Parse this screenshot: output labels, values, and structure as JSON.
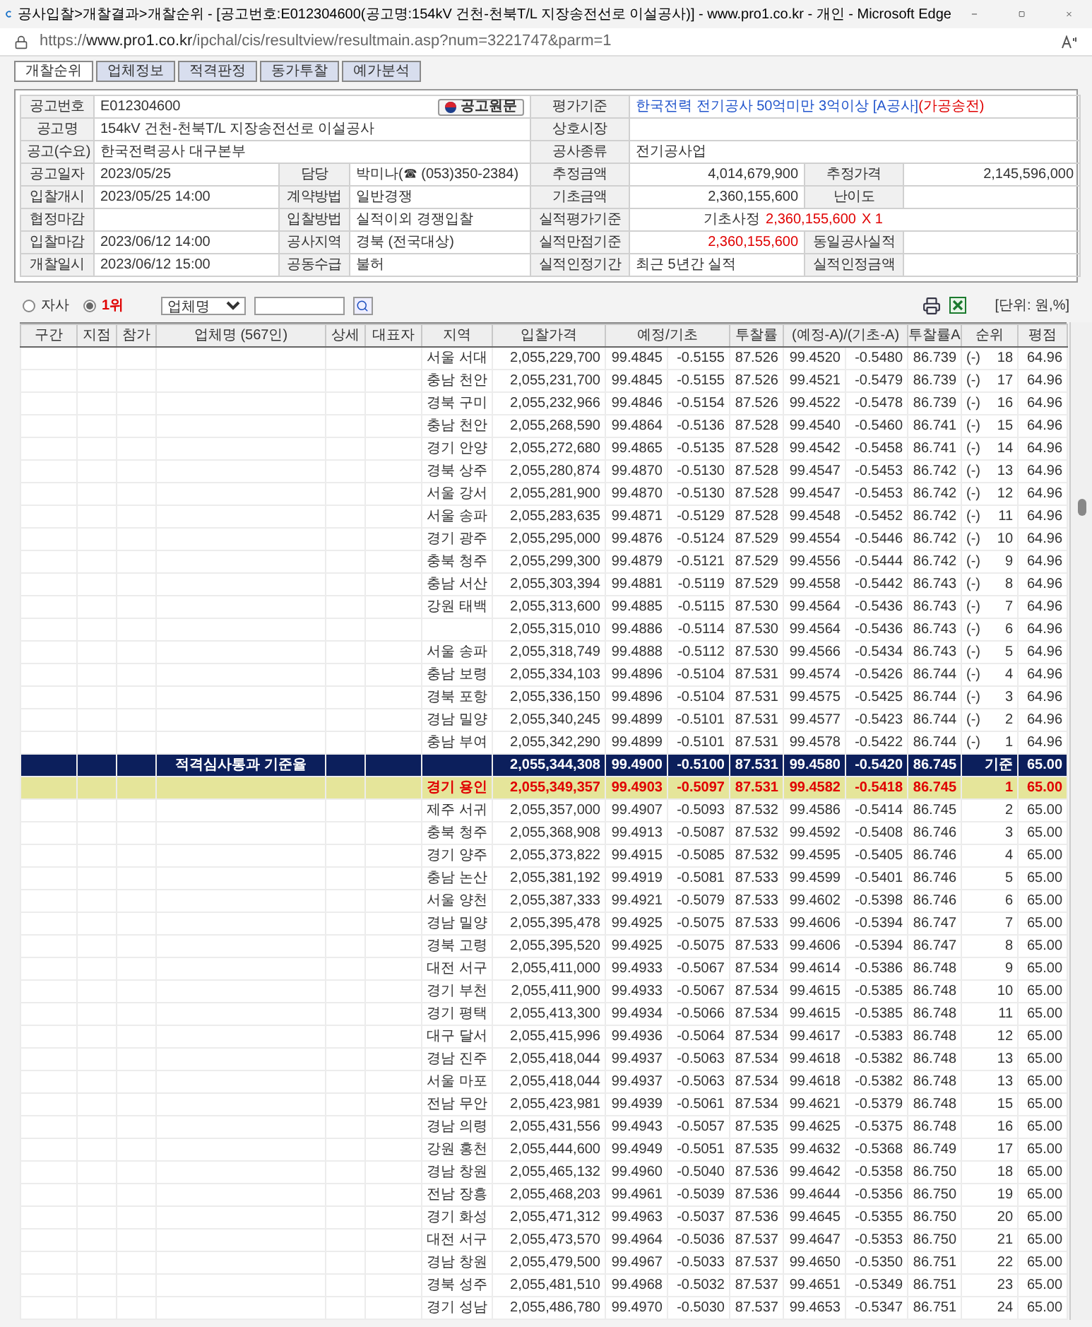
{
  "window": {
    "title": "공사입찰>개찰결과>개찰순위 - [공고번호:E012304600(공고명:154kV 건천-천북T/L 지장송전선로 이설공사)] - www.pro1.co.kr - 개인 - Microsoft Edge",
    "url_prefix": "https://",
    "url_domain": "www.pro1.co.kr",
    "url_path": "/ipchal/cis/resultview/resultmain.asp?num=3221747&parm=1"
  },
  "tabs": [
    {
      "label": "개찰순위",
      "selected": true
    },
    {
      "label": "업체정보",
      "selected": false
    },
    {
      "label": "적격판정",
      "selected": false
    },
    {
      "label": "동가투찰",
      "selected": false
    },
    {
      "label": "예가분석",
      "selected": false
    }
  ],
  "info_rows": [
    [
      {
        "kind": "label",
        "text": "공고번호"
      },
      {
        "kind": "notice",
        "text": "E012304600",
        "button": "공고원문"
      },
      {
        "kind": "label",
        "text": "평가기준"
      },
      {
        "kind": "text",
        "parts": [
          {
            "text": "한국전력 전기공사  50억미만 3억이상 [A공사]",
            "color": "#2255cc"
          },
          {
            "text": "(가공송전)",
            "color": "#e00000"
          }
        ]
      }
    ],
    [
      {
        "kind": "label",
        "text": "공고명"
      },
      {
        "kind": "text",
        "text": "154kV 건천-천북T/L 지장송전선로 이설공사"
      },
      {
        "kind": "label",
        "text": "상호시장"
      },
      {
        "kind": "empty"
      }
    ],
    [
      {
        "kind": "label",
        "text": "공고(수요)"
      },
      {
        "kind": "text",
        "text": "한국전력공사 대구본부"
      },
      {
        "kind": "label",
        "text": "공사종류"
      },
      {
        "kind": "text",
        "text": "전기공사업"
      }
    ],
    [
      {
        "kind": "label",
        "text": "공고일자"
      },
      {
        "kind": "text",
        "text": "2023/05/25"
      },
      {
        "kind": "label",
        "text": "담당"
      },
      {
        "kind": "text",
        "text": "박미나(☎ (053)350-2384)"
      },
      {
        "kind": "label",
        "text": "추정금액"
      },
      {
        "kind": "amount",
        "text": "4,014,679,900"
      },
      {
        "kind": "label",
        "text": "추정가격"
      },
      {
        "kind": "amount",
        "text": "2,145,596,000"
      }
    ],
    [
      {
        "kind": "label",
        "text": "입찰개시"
      },
      {
        "kind": "text",
        "text": "2023/05/25 14:00"
      },
      {
        "kind": "label",
        "text": "계약방법"
      },
      {
        "kind": "text",
        "text": "일반경쟁"
      },
      {
        "kind": "label",
        "text": "기초금액"
      },
      {
        "kind": "amount",
        "text": "2,360,155,600"
      },
      {
        "kind": "label",
        "text": "난이도"
      },
      {
        "kind": "empty"
      }
    ],
    [
      {
        "kind": "label",
        "text": "협정마감"
      },
      {
        "kind": "empty"
      },
      {
        "kind": "label",
        "text": "입찰방법"
      },
      {
        "kind": "text",
        "text": "실적이외 경쟁입찰"
      },
      {
        "kind": "label",
        "text": "실적평가기준"
      },
      {
        "kind": "formula",
        "parts": [
          {
            "text": "기초사정",
            "color": "#333333"
          },
          {
            "text": "2,360,155,600",
            "color": "#e00000"
          },
          {
            "text": "X 1",
            "color": "#e00000"
          }
        ]
      }
    ],
    [
      {
        "kind": "label",
        "text": "입찰마감"
      },
      {
        "kind": "text",
        "text": "2023/06/12 14:00"
      },
      {
        "kind": "label",
        "text": "공사지역"
      },
      {
        "kind": "text",
        "text": "경북 (전국대상)"
      },
      {
        "kind": "label",
        "text": "실적만점기준"
      },
      {
        "kind": "amount",
        "text": "2,360,155,600",
        "color": "#e00000"
      },
      {
        "kind": "label",
        "text": "동일공사실적"
      },
      {
        "kind": "empty"
      }
    ],
    [
      {
        "kind": "label",
        "text": "개찰일시"
      },
      {
        "kind": "text",
        "text": "2023/06/12 15:00"
      },
      {
        "kind": "label",
        "text": "공동수급"
      },
      {
        "kind": "text",
        "text": "불허"
      },
      {
        "kind": "label",
        "text": "실적인정기간"
      },
      {
        "kind": "text",
        "text": "최근 5년간 실적"
      },
      {
        "kind": "label",
        "text": "실적인정금액"
      },
      {
        "kind": "empty"
      }
    ]
  ],
  "filter": {
    "radios": [
      {
        "label": "자사",
        "selected": false
      },
      {
        "label": "1위",
        "selected": true
      }
    ],
    "select": "업체명",
    "unit": "[단위: 원,%]"
  },
  "columns": [
    {
      "label": "구간"
    },
    {
      "label": "지점"
    },
    {
      "label": "참가"
    },
    {
      "label": "업체명 (567인)"
    },
    {
      "label": "상세"
    },
    {
      "label": "대표자"
    },
    {
      "label": "지역"
    },
    {
      "label": "입찰가격"
    },
    {
      "label": "예정/기초",
      "kind": "pair"
    },
    {
      "label": "투찰률"
    },
    {
      "label": "(예정-A)/(기초-A)",
      "kind": "pair"
    },
    {
      "label": "투찰률A"
    },
    {
      "label": "순위"
    },
    {
      "label": "평점"
    }
  ],
  "rows": [
    {
      "kind": "normal",
      "region": "서울 서대",
      "values": [
        "2,055,229,700",
        "99.4845",
        "-0.5155",
        "87.526",
        "99.4520",
        "-0.5480",
        "86.739"
      ],
      "rank_mark": "(-)",
      "rank": "18",
      "score": "64.96"
    },
    {
      "kind": "normal",
      "region": "충남 천안",
      "values": [
        "2,055,231,700",
        "99.4845",
        "-0.5155",
        "87.526",
        "99.4521",
        "-0.5479",
        "86.739"
      ],
      "rank_mark": "(-)",
      "rank": "17",
      "score": "64.96"
    },
    {
      "kind": "normal",
      "region": "경북 구미",
      "values": [
        "2,055,232,966",
        "99.4846",
        "-0.5154",
        "87.526",
        "99.4522",
        "-0.5478",
        "86.739"
      ],
      "rank_mark": "(-)",
      "rank": "16",
      "score": "64.96"
    },
    {
      "kind": "normal",
      "region": "충남 천안",
      "values": [
        "2,055,268,590",
        "99.4864",
        "-0.5136",
        "87.528",
        "99.4540",
        "-0.5460",
        "86.741"
      ],
      "rank_mark": "(-)",
      "rank": "15",
      "score": "64.96"
    },
    {
      "kind": "normal",
      "region": "경기 안양",
      "values": [
        "2,055,272,680",
        "99.4865",
        "-0.5135",
        "87.528",
        "99.4542",
        "-0.5458",
        "86.741"
      ],
      "rank_mark": "(-)",
      "rank": "14",
      "score": "64.96"
    },
    {
      "kind": "normal",
      "region": "경북 상주",
      "values": [
        "2,055,280,874",
        "99.4870",
        "-0.5130",
        "87.528",
        "99.4547",
        "-0.5453",
        "86.742"
      ],
      "rank_mark": "(-)",
      "rank": "13",
      "score": "64.96"
    },
    {
      "kind": "normal",
      "region": "서울 강서",
      "values": [
        "2,055,281,900",
        "99.4870",
        "-0.5130",
        "87.528",
        "99.4547",
        "-0.5453",
        "86.742"
      ],
      "rank_mark": "(-)",
      "rank": "12",
      "score": "64.96"
    },
    {
      "kind": "normal",
      "region": "서울 송파",
      "values": [
        "2,055,283,635",
        "99.4871",
        "-0.5129",
        "87.528",
        "99.4548",
        "-0.5452",
        "86.742"
      ],
      "rank_mark": "(-)",
      "rank": "11",
      "score": "64.96"
    },
    {
      "kind": "normal",
      "region": "경기 광주",
      "values": [
        "2,055,295,000",
        "99.4876",
        "-0.5124",
        "87.529",
        "99.4554",
        "-0.5446",
        "86.742"
      ],
      "rank_mark": "(-)",
      "rank": "10",
      "score": "64.96"
    },
    {
      "kind": "normal",
      "region": "충북 청주",
      "values": [
        "2,055,299,300",
        "99.4879",
        "-0.5121",
        "87.529",
        "99.4556",
        "-0.5444",
        "86.742"
      ],
      "rank_mark": "(-)",
      "rank": "9",
      "score": "64.96"
    },
    {
      "kind": "normal",
      "region": "충남 서산",
      "values": [
        "2,055,303,394",
        "99.4881",
        "-0.5119",
        "87.529",
        "99.4558",
        "-0.5442",
        "86.743"
      ],
      "rank_mark": "(-)",
      "rank": "8",
      "score": "64.96"
    },
    {
      "kind": "normal",
      "region": "강원 태백",
      "values": [
        "2,055,313,600",
        "99.4885",
        "-0.5115",
        "87.530",
        "99.4564",
        "-0.5436",
        "86.743"
      ],
      "rank_mark": "(-)",
      "rank": "7",
      "score": "64.96"
    },
    {
      "kind": "normal",
      "values": [
        "2,055,315,010",
        "99.4886",
        "-0.5114",
        "87.530",
        "99.4564",
        "-0.5436",
        "86.743"
      ],
      "rank_mark": "(-)",
      "rank": "6",
      "score": "64.96"
    },
    {
      "kind": "normal",
      "region": "서울 송파",
      "values": [
        "2,055,318,749",
        "99.4888",
        "-0.5112",
        "87.530",
        "99.4566",
        "-0.5434",
        "86.743"
      ],
      "rank_mark": "(-)",
      "rank": "5",
      "score": "64.96"
    },
    {
      "kind": "normal",
      "region": "충남 보령",
      "values": [
        "2,055,334,103",
        "99.4896",
        "-0.5104",
        "87.531",
        "99.4574",
        "-0.5426",
        "86.744"
      ],
      "rank_mark": "(-)",
      "rank": "4",
      "score": "64.96"
    },
    {
      "kind": "normal",
      "region": "경북 포항",
      "values": [
        "2,055,336,150",
        "99.4896",
        "-0.5104",
        "87.531",
        "99.4575",
        "-0.5425",
        "86.744"
      ],
      "rank_mark": "(-)",
      "rank": "3",
      "score": "64.96"
    },
    {
      "kind": "normal",
      "region": "경남 밀양",
      "values": [
        "2,055,340,245",
        "99.4899",
        "-0.5101",
        "87.531",
        "99.4577",
        "-0.5423",
        "86.744"
      ],
      "rank_mark": "(-)",
      "rank": "2",
      "score": "64.96"
    },
    {
      "kind": "normal",
      "region": "충남 부여",
      "values": [
        "2,055,342,290",
        "99.4899",
        "-0.5101",
        "87.531",
        "99.4578",
        "-0.5422",
        "86.744"
      ],
      "rank_mark": "(-)",
      "rank": "1",
      "score": "64.96"
    },
    {
      "kind": "summary",
      "label": "적격심사통과 기준율",
      "values": [
        "2,055,344,308",
        "99.4900",
        "-0.5100",
        "87.531",
        "99.4580",
        "-0.5420",
        "86.745"
      ],
      "rank": "기준",
      "score": "65.00"
    },
    {
      "kind": "highlight",
      "region": "경기 용인",
      "values": [
        "2,055,349,357",
        "99.4903",
        "-0.5097",
        "87.531",
        "99.4582",
        "-0.5418",
        "86.745"
      ],
      "rank": "1",
      "score": "65.00"
    },
    {
      "kind": "normal",
      "region": "제주 서귀",
      "values": [
        "2,055,357,000",
        "99.4907",
        "-0.5093",
        "87.532",
        "99.4586",
        "-0.5414",
        "86.745"
      ],
      "rank": "2",
      "score": "65.00"
    },
    {
      "kind": "normal",
      "region": "충북 청주",
      "values": [
        "2,055,368,908",
        "99.4913",
        "-0.5087",
        "87.532",
        "99.4592",
        "-0.5408",
        "86.746"
      ],
      "rank": "3",
      "score": "65.00"
    },
    {
      "kind": "normal",
      "region": "경기 양주",
      "values": [
        "2,055,373,822",
        "99.4915",
        "-0.5085",
        "87.532",
        "99.4595",
        "-0.5405",
        "86.746"
      ],
      "rank": "4",
      "score": "65.00"
    },
    {
      "kind": "normal",
      "region": "충남 논산",
      "values": [
        "2,055,381,192",
        "99.4919",
        "-0.5081",
        "87.533",
        "99.4599",
        "-0.5401",
        "86.746"
      ],
      "rank": "5",
      "score": "65.00"
    },
    {
      "kind": "normal",
      "region": "서울 양천",
      "values": [
        "2,055,387,333",
        "99.4921",
        "-0.5079",
        "87.533",
        "99.4602",
        "-0.5398",
        "86.746"
      ],
      "rank": "6",
      "score": "65.00"
    },
    {
      "kind": "normal",
      "region": "경남 밀양",
      "values": [
        "2,055,395,478",
        "99.4925",
        "-0.5075",
        "87.533",
        "99.4606",
        "-0.5394",
        "86.747"
      ],
      "rank": "7",
      "score": "65.00"
    },
    {
      "kind": "normal",
      "region": "경북 고령",
      "values": [
        "2,055,395,520",
        "99.4925",
        "-0.5075",
        "87.533",
        "99.4606",
        "-0.5394",
        "86.747"
      ],
      "rank": "8",
      "score": "65.00"
    },
    {
      "kind": "normal",
      "region": "대전 서구",
      "values": [
        "2,055,411,000",
        "99.4933",
        "-0.5067",
        "87.534",
        "99.4614",
        "-0.5386",
        "86.748"
      ],
      "rank": "9",
      "score": "65.00"
    },
    {
      "kind": "normal",
      "region": "경기 부천",
      "values": [
        "2,055,411,900",
        "99.4933",
        "-0.5067",
        "87.534",
        "99.4615",
        "-0.5385",
        "86.748"
      ],
      "rank": "10",
      "score": "65.00"
    },
    {
      "kind": "normal",
      "region": "경기 평택",
      "values": [
        "2,055,413,300",
        "99.4934",
        "-0.5066",
        "87.534",
        "99.4615",
        "-0.5385",
        "86.748"
      ],
      "rank": "11",
      "score": "65.00"
    },
    {
      "kind": "normal",
      "region": "대구 달서",
      "values": [
        "2,055,415,996",
        "99.4936",
        "-0.5064",
        "87.534",
        "99.4617",
        "-0.5383",
        "86.748"
      ],
      "rank": "12",
      "score": "65.00"
    },
    {
      "kind": "normal",
      "region": "경남 진주",
      "values": [
        "2,055,418,044",
        "99.4937",
        "-0.5063",
        "87.534",
        "99.4618",
        "-0.5382",
        "86.748"
      ],
      "rank": "13",
      "score": "65.00"
    },
    {
      "kind": "normal",
      "region": "서울 마포",
      "values": [
        "2,055,418,044",
        "99.4937",
        "-0.5063",
        "87.534",
        "99.4618",
        "-0.5382",
        "86.748"
      ],
      "rank": "13",
      "score": "65.00"
    },
    {
      "kind": "normal",
      "region": "전남 무안",
      "values": [
        "2,055,423,981",
        "99.4939",
        "-0.5061",
        "87.534",
        "99.4621",
        "-0.5379",
        "86.748"
      ],
      "rank": "15",
      "score": "65.00"
    },
    {
      "kind": "normal",
      "region": "경남 의령",
      "values": [
        "2,055,431,556",
        "99.4943",
        "-0.5057",
        "87.535",
        "99.4625",
        "-0.5375",
        "86.748"
      ],
      "rank": "16",
      "score": "65.00"
    },
    {
      "kind": "normal",
      "region": "강원 홍천",
      "values": [
        "2,055,444,600",
        "99.4949",
        "-0.5051",
        "87.535",
        "99.4632",
        "-0.5368",
        "86.749"
      ],
      "rank": "17",
      "score": "65.00"
    },
    {
      "kind": "normal",
      "region": "경남 창원",
      "values": [
        "2,055,465,132",
        "99.4960",
        "-0.5040",
        "87.536",
        "99.4642",
        "-0.5358",
        "86.750"
      ],
      "rank": "18",
      "score": "65.00"
    },
    {
      "kind": "normal",
      "region": "전남 장흥",
      "values": [
        "2,055,468,203",
        "99.4961",
        "-0.5039",
        "87.536",
        "99.4644",
        "-0.5356",
        "86.750"
      ],
      "rank": "19",
      "score": "65.00"
    },
    {
      "kind": "normal",
      "region": "경기 화성",
      "values": [
        "2,055,471,312",
        "99.4963",
        "-0.5037",
        "87.536",
        "99.4645",
        "-0.5355",
        "86.750"
      ],
      "rank": "20",
      "score": "65.00"
    },
    {
      "kind": "normal",
      "region": "대전 서구",
      "values": [
        "2,055,473,570",
        "99.4964",
        "-0.5036",
        "87.537",
        "99.4647",
        "-0.5353",
        "86.750"
      ],
      "rank": "21",
      "score": "65.00"
    },
    {
      "kind": "normal",
      "region": "경남 창원",
      "values": [
        "2,055,479,500",
        "99.4967",
        "-0.5033",
        "87.537",
        "99.4650",
        "-0.5350",
        "86.751"
      ],
      "rank": "22",
      "score": "65.00"
    },
    {
      "kind": "normal",
      "region": "경북 성주",
      "values": [
        "2,055,481,510",
        "99.4968",
        "-0.5032",
        "87.537",
        "99.4651",
        "-0.5349",
        "86.751"
      ],
      "rank": "23",
      "score": "65.00"
    },
    {
      "kind": "normal",
      "region": "경기 성남",
      "values": [
        "2,055,486,780",
        "99.4970",
        "-0.5030",
        "87.537",
        "99.4653",
        "-0.5347",
        "86.751"
      ],
      "rank": "24",
      "score": "65.00"
    }
  ]
}
